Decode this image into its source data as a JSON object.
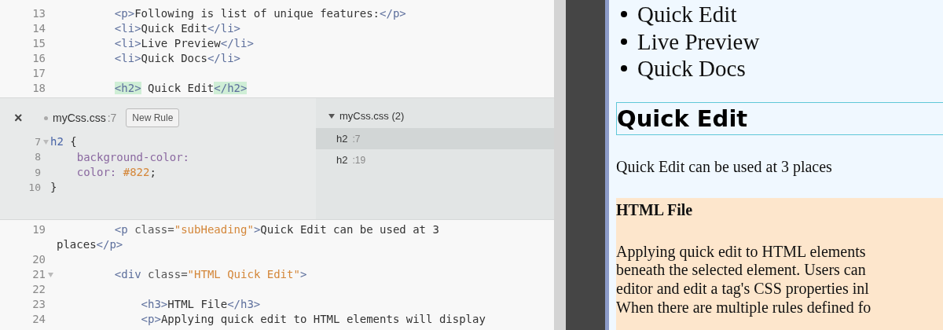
{
  "editor": {
    "lines_above": [
      {
        "number": "13",
        "segments": [
          {
            "kind": "tag",
            "text": "         <p>"
          },
          {
            "kind": "text",
            "text": "Following is list of unique features:"
          },
          {
            "kind": "tag",
            "text": "</p>"
          }
        ]
      },
      {
        "number": "14",
        "segments": [
          {
            "kind": "tag",
            "text": "         <li>"
          },
          {
            "kind": "text",
            "text": "Quick Edit"
          },
          {
            "kind": "tag",
            "text": "</li>"
          }
        ]
      },
      {
        "number": "15",
        "segments": [
          {
            "kind": "tag",
            "text": "         <li>"
          },
          {
            "kind": "text",
            "text": "Live Preview"
          },
          {
            "kind": "tag",
            "text": "</li>"
          }
        ]
      },
      {
        "number": "16",
        "segments": [
          {
            "kind": "tag",
            "text": "         <li>"
          },
          {
            "kind": "text",
            "text": "Quick Docs"
          },
          {
            "kind": "tag",
            "text": "</li>"
          }
        ]
      },
      {
        "number": "17"
      },
      {
        "number": "18",
        "segments": [
          {
            "kind": "match",
            "text": "         <h2>"
          },
          {
            "kind": "text",
            "text": " Quick Edit"
          },
          {
            "kind": "match",
            "text": "</h2>"
          }
        ]
      }
    ],
    "inline_editor": {
      "close": "×",
      "file": "myCss.css",
      "file_line": ":7",
      "new_rule_button": "New Rule",
      "code": [
        {
          "number": "7",
          "foldable": true,
          "segments": [
            {
              "kind": "selector",
              "text": "h2"
            },
            {
              "kind": "text",
              "text": " {"
            }
          ]
        },
        {
          "number": "8",
          "foldable": false,
          "segments": [
            {
              "kind": "property",
              "text": "    background-color:"
            }
          ]
        },
        {
          "number": "9",
          "foldable": false,
          "segments": [
            {
              "kind": "property",
              "text": "    color: "
            },
            {
              "kind": "string",
              "text": "#822"
            },
            {
              "kind": "text",
              "text": ";"
            }
          ]
        },
        {
          "number": "10",
          "foldable": false,
          "segments": [
            {
              "kind": "text",
              "text": "}"
            }
          ]
        }
      ],
      "rules_header": "myCss.css (2)",
      "rules": [
        {
          "selector": "h2",
          "line": ":7",
          "selected": true
        },
        {
          "selector": "h2",
          "line": ":19",
          "selected": false
        }
      ]
    },
    "lines_below": [
      {
        "number": "19",
        "foldable": false,
        "segments": [
          {
            "kind": "tag",
            "text": "         <p "
          },
          {
            "kind": "attr",
            "text": "class="
          },
          {
            "kind": "string",
            "text": "\"subHeading\""
          },
          {
            "kind": "tag",
            "text": ">"
          },
          {
            "kind": "text",
            "text": "Quick Edit can be used at 3"
          }
        ],
        "continuation": [
          {
            "kind": "text",
            "text": "places"
          },
          {
            "kind": "tag",
            "text": "</p>"
          }
        ]
      },
      {
        "number": "20",
        "foldable": false
      },
      {
        "number": "21",
        "foldable": true,
        "segments": [
          {
            "kind": "tag",
            "text": "         <div "
          },
          {
            "kind": "attr",
            "text": "class="
          },
          {
            "kind": "string",
            "text": "\"HTML Quick Edit\""
          },
          {
            "kind": "tag",
            "text": ">"
          }
        ]
      },
      {
        "number": "22",
        "foldable": false
      },
      {
        "number": "23",
        "foldable": false,
        "segments": [
          {
            "kind": "tag",
            "text": "             <h3>"
          },
          {
            "kind": "text",
            "text": "HTML File"
          },
          {
            "kind": "tag",
            "text": "</h3>"
          }
        ]
      },
      {
        "number": "24",
        "foldable": false,
        "segments": [
          {
            "kind": "tag",
            "text": "             <p>"
          },
          {
            "kind": "text",
            "text": "Applying quick edit to HTML elements will display"
          }
        ]
      }
    ]
  },
  "preview": {
    "list": [
      "Quick Edit",
      "Live Preview",
      "Quick Docs"
    ],
    "heading": "Quick Edit",
    "subheading": "Quick Edit can be used at 3 places",
    "section": {
      "title": "HTML File",
      "lines": [
        "Applying quick edit to HTML elements",
        "beneath the selected element. Users can",
        "editor and edit a tag's CSS properties inl",
        "When there are multiple rules defined fo"
      ]
    }
  }
}
